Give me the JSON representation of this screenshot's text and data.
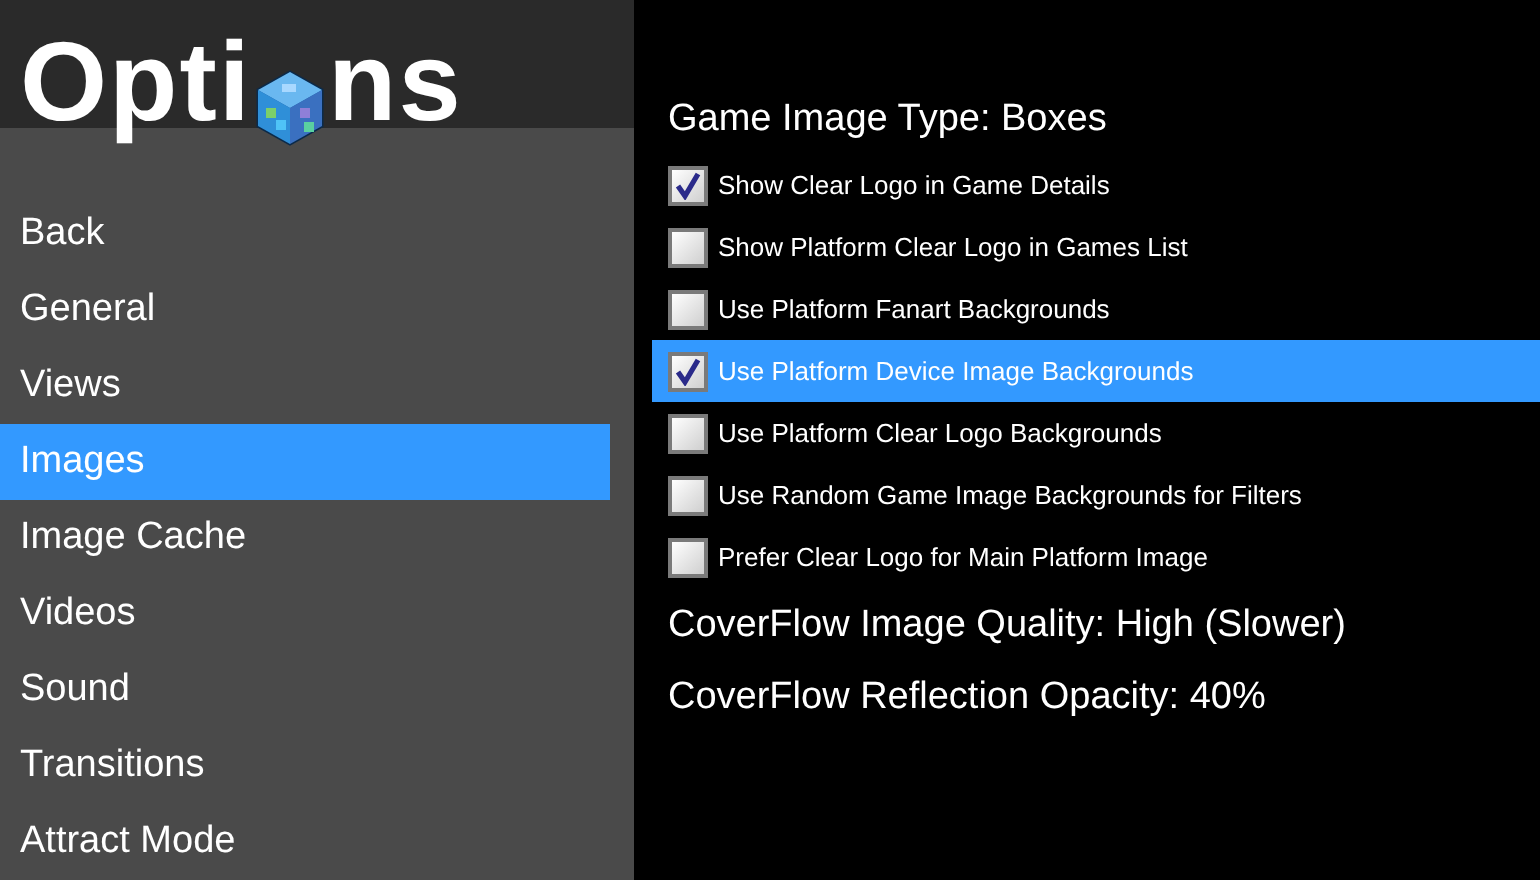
{
  "title": {
    "start": "Opti",
    "end": "ns"
  },
  "menu": [
    {
      "label": "Back",
      "selected": false
    },
    {
      "label": "General",
      "selected": false
    },
    {
      "label": "Views",
      "selected": false
    },
    {
      "label": "Images",
      "selected": true
    },
    {
      "label": "Image Cache",
      "selected": false
    },
    {
      "label": "Videos",
      "selected": false
    },
    {
      "label": "Sound",
      "selected": false
    },
    {
      "label": "Transitions",
      "selected": false
    },
    {
      "label": "Attract Mode",
      "selected": false
    }
  ],
  "settings": [
    {
      "kind": "label",
      "label": "Game Image Type: Boxes",
      "selected": false
    },
    {
      "kind": "checkbox",
      "label": "Show Clear Logo in Game Details",
      "checked": true,
      "selected": false
    },
    {
      "kind": "checkbox",
      "label": "Show Platform Clear Logo in Games List",
      "checked": false,
      "selected": false
    },
    {
      "kind": "checkbox",
      "label": "Use Platform Fanart Backgrounds",
      "checked": false,
      "selected": false
    },
    {
      "kind": "checkbox",
      "label": "Use Platform Device Image Backgrounds",
      "checked": true,
      "selected": true
    },
    {
      "kind": "checkbox",
      "label": "Use Platform Clear Logo Backgrounds",
      "checked": false,
      "selected": false
    },
    {
      "kind": "checkbox",
      "label": "Use Random Game Image Backgrounds for Filters",
      "checked": false,
      "selected": false
    },
    {
      "kind": "checkbox",
      "label": "Prefer Clear Logo for Main Platform Image",
      "checked": false,
      "selected": false
    },
    {
      "kind": "label",
      "label": "CoverFlow Image Quality: High (Slower)",
      "selected": false
    },
    {
      "kind": "label",
      "label": "CoverFlow Reflection Opacity: 40%",
      "selected": false
    }
  ]
}
